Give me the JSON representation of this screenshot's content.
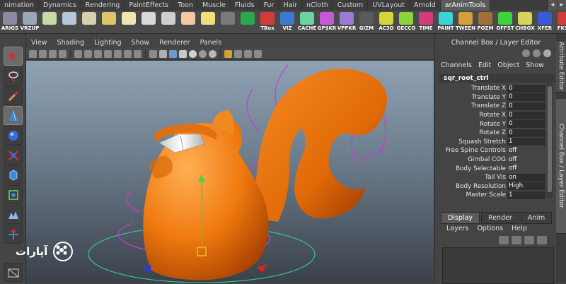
{
  "shelf_tabs": {
    "items": [
      "nimation",
      "Dynamics",
      "Rendering",
      "PaintEffects",
      "Toon",
      "Muscle",
      "Fluids",
      "Fur",
      "Hair",
      "nCloth",
      "Custom",
      "UVLayout",
      "Arnold",
      "arAnimTools"
    ],
    "active_index": 13
  },
  "shelf": {
    "buttons": [
      {
        "label": "ARIGS",
        "color": "#8a8aa0"
      },
      {
        "label": "VRZUP",
        "color": "#9aa7b8"
      },
      {
        "label": "",
        "color": "#c9d9a6"
      },
      {
        "label": "",
        "color": "#b6c7d9"
      },
      {
        "label": "",
        "color": "#d8d0b0"
      },
      {
        "label": "",
        "color": "#e0c46a"
      },
      {
        "label": "",
        "color": "#f0e6b0"
      },
      {
        "label": "",
        "color": "#d9d9d9"
      },
      {
        "label": "",
        "color": "#cfcfcf"
      },
      {
        "label": "",
        "color": "#f3c7a0"
      },
      {
        "label": "",
        "color": "#f0e07a"
      },
      {
        "label": "",
        "color": "#7a7a7a"
      },
      {
        "label": "",
        "color": "#2aa84a"
      },
      {
        "label": "TBox",
        "color": "#d53a3a"
      },
      {
        "label": "VIZ",
        "color": "#3a7ad5"
      },
      {
        "label": "CACHE",
        "color": "#6ad5a0"
      },
      {
        "label": "GP$KR",
        "color": "#c45ad5"
      },
      {
        "label": "VPPKR",
        "color": "#9a7ad5"
      },
      {
        "label": "GIZM",
        "color": "#5a5a5a"
      },
      {
        "label": "AC3D",
        "color": "#d5d53a"
      },
      {
        "label": "GECCO",
        "color": "#8ad53a"
      },
      {
        "label": "TIME",
        "color": "#d53a7a"
      },
      {
        "label": "PAINT",
        "color": "#3ad5d5"
      },
      {
        "label": "TWEEN",
        "color": "#d5a03a"
      },
      {
        "label": "POZM",
        "color": "#a0703a"
      },
      {
        "label": "OFFST",
        "color": "#3ad53a"
      },
      {
        "label": "CHBOX",
        "color": "#d5d55a"
      },
      {
        "label": "XFER",
        "color": "#3a5ad5"
      },
      {
        "label": "FKSII",
        "color": "#d53a3a"
      }
    ]
  },
  "viewport": {
    "menu": [
      "View",
      "Shading",
      "Lighting",
      "Show",
      "Renderer",
      "Panels"
    ]
  },
  "channel_box": {
    "title": "Channel Box / Layer Editor",
    "menu": [
      "Channels",
      "Edit",
      "Object",
      "Show"
    ],
    "object": "sqr_root_ctrl",
    "attributes": [
      {
        "name": "Translate X",
        "value": "0",
        "field": true
      },
      {
        "name": "Translate Y",
        "value": "0",
        "field": true
      },
      {
        "name": "Translate Z",
        "value": "0",
        "field": true
      },
      {
        "name": "Rotate X",
        "value": "0",
        "field": true
      },
      {
        "name": "Rotate Y",
        "value": "0",
        "field": true
      },
      {
        "name": "Rotate Z",
        "value": "0",
        "field": true
      },
      {
        "name": "Squash Stretch",
        "value": "1",
        "field": true
      },
      {
        "name": "Free Spine Controls",
        "value": "off",
        "field": false
      },
      {
        "name": "Gimbal COG",
        "value": "off",
        "field": false
      },
      {
        "name": "Body Selectable",
        "value": "off",
        "field": false
      },
      {
        "name": "Tail Vis",
        "value": "on",
        "field": true
      },
      {
        "name": "Body Resolution",
        "value": "High",
        "field": true
      },
      {
        "name": "Master Scale",
        "value": "1",
        "field": true
      }
    ]
  },
  "layer_editor": {
    "tabs": [
      "Display",
      "Render",
      "Anim"
    ],
    "active_tab": 0,
    "menu": [
      "Layers",
      "Options",
      "Help"
    ]
  },
  "side_tabs": [
    "Attribute Editor",
    "Channel Box / Layer Editor"
  ],
  "watermark": "آپارات"
}
